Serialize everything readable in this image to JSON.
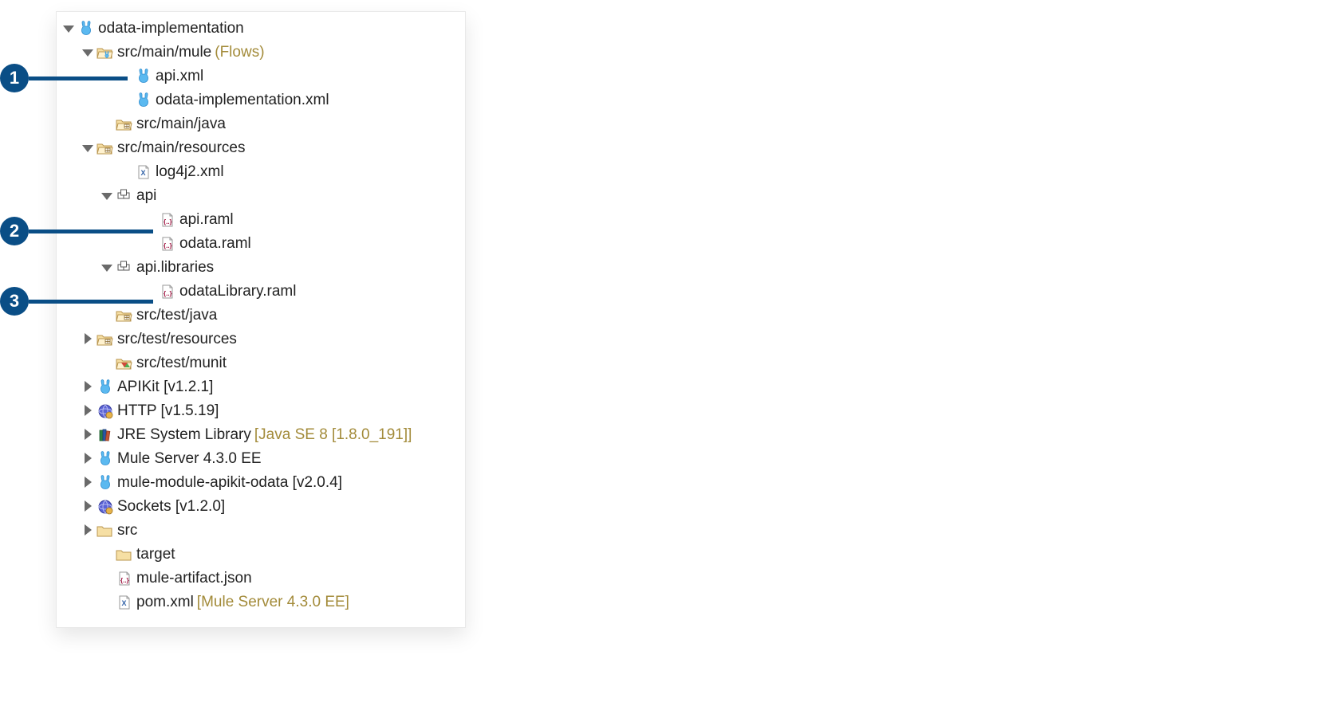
{
  "callouts": [
    "1",
    "2",
    "3"
  ],
  "tree": {
    "root": {
      "label": "odata-implementation"
    },
    "flows": {
      "label": "src/main/mule",
      "suffix": "(Flows)"
    },
    "api_xml": "api.xml",
    "odata_impl_xml": "odata-implementation.xml",
    "src_main_java": "src/main/java",
    "src_main_resources": "src/main/resources",
    "log4j2": "log4j2.xml",
    "api_pkg": "api",
    "api_raml": "api.raml",
    "odata_raml": "odata.raml",
    "api_libraries": "api.libraries",
    "odata_library_raml": "odataLibrary.raml",
    "src_test_java": "src/test/java",
    "src_test_resources": "src/test/resources",
    "src_test_munit": "src/test/munit",
    "apikit": "APIKit [v1.2.1]",
    "http": "HTTP [v1.5.19]",
    "jre": {
      "label": "JRE System Library",
      "suffix": "[Java SE 8 [1.8.0_191]]"
    },
    "mule_server": "Mule Server 4.3.0 EE",
    "mule_module_odata": "mule-module-apikit-odata [v2.0.4]",
    "sockets": "Sockets [v1.2.0]",
    "src": "src",
    "target": "target",
    "mule_artifact": "mule-artifact.json",
    "pom": {
      "label": "pom.xml",
      "suffix": "[Mule Server 4.3.0 EE]"
    }
  }
}
